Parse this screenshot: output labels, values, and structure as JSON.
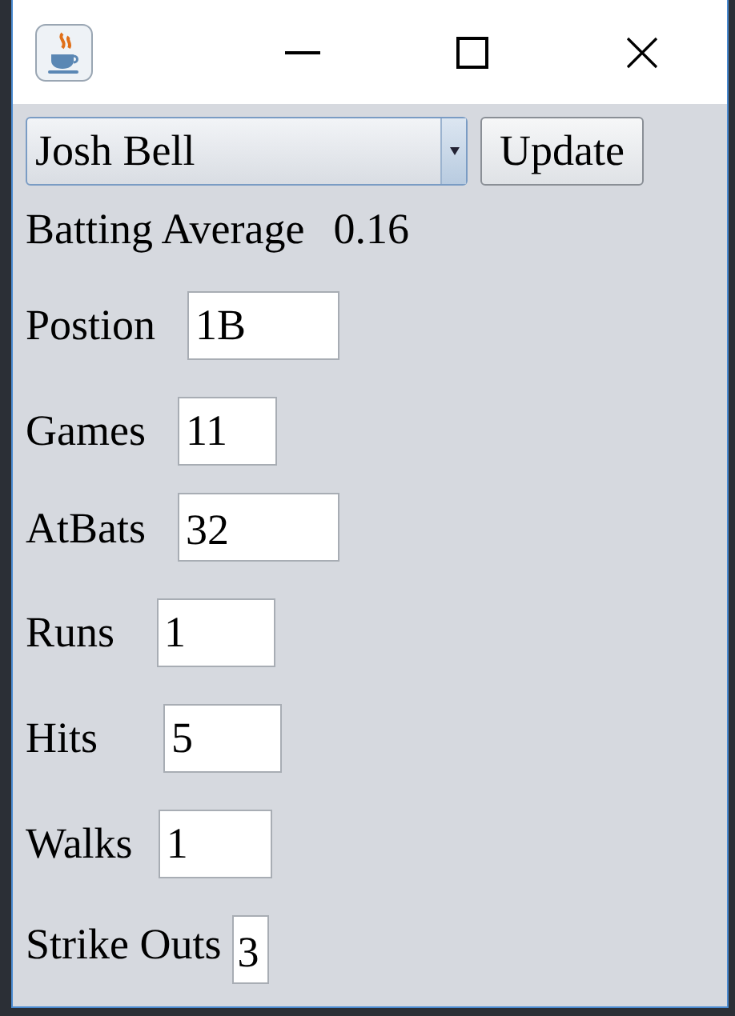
{
  "player_select": {
    "value": "Josh Bell"
  },
  "update_button": "Update",
  "batting_average": {
    "label": "Batting Average",
    "value": "0.16"
  },
  "fields": [
    {
      "label": "Postion",
      "value": "1B"
    },
    {
      "label": "Games",
      "value": "11"
    },
    {
      "label": "AtBats",
      "value": "32"
    },
    {
      "label": "Runs",
      "value": "1"
    },
    {
      "label": "Hits",
      "value": "5"
    },
    {
      "label": "Walks",
      "value": "1"
    },
    {
      "label": "Strike Outs",
      "value": "3"
    }
  ]
}
